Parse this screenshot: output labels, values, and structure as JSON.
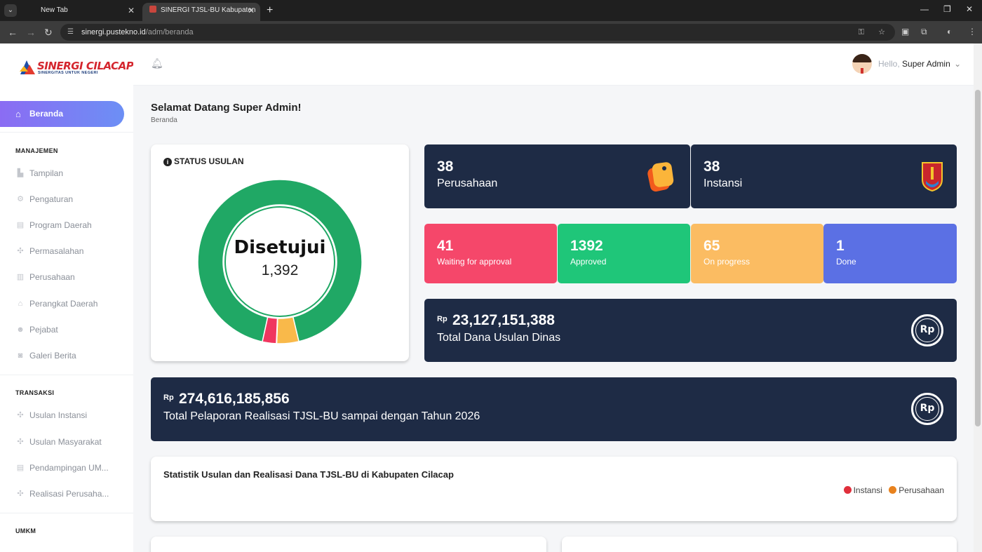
{
  "browser": {
    "tabs": [
      {
        "title": "New Tab"
      },
      {
        "title": "SINERGI TJSL-BU Kabupaten Cil"
      }
    ],
    "url_host": "sinergi.pustekno.id",
    "url_path": "/adm/beranda"
  },
  "logo": {
    "name": "SINERGI CILACAP",
    "tagline": "SINERGITAS UNTUK NEGERI"
  },
  "sidebar": {
    "active": "Beranda",
    "sections": [
      {
        "title": "MANAJEMEN",
        "items": [
          "Tampilan",
          "Pengaturan",
          "Program Daerah",
          "Permasalahan",
          "Perusahaan",
          "Perangkat Daerah",
          "Pejabat",
          "Galeri Berita"
        ]
      },
      {
        "title": "TRANSAKSI",
        "items": [
          "Usulan Instansi",
          "Usulan Masyarakat",
          "Pendampingan UM...",
          "Realisasi Perusaha..."
        ]
      },
      {
        "title": "UMKM",
        "items": []
      }
    ]
  },
  "header": {
    "hello": "Hello,",
    "user": "Super Admin"
  },
  "page": {
    "title": "Selamat Datang Super Admin!",
    "breadcrumb": "Beranda"
  },
  "status_usulan": {
    "title": "STATUS USULAN",
    "center_label": "Disetujui",
    "center_value": "1,392",
    "colors": {
      "approved": "#20a865",
      "progress": "#f9b94a",
      "waiting": "#f0365f",
      "done": "#5468d8"
    }
  },
  "stats_top": [
    {
      "value": "38",
      "label": "Perusahaan"
    },
    {
      "value": "38",
      "label": "Instansi"
    }
  ],
  "stats_status": [
    {
      "value": "41",
      "label": "Waiting for approval",
      "color": "#f5476a"
    },
    {
      "value": "1392",
      "label": "Approved",
      "color": "#1fc679"
    },
    {
      "value": "65",
      "label": "On progress",
      "color": "#fbbc62"
    },
    {
      "value": "1",
      "label": "Done",
      "color": "#5b70e4"
    }
  ],
  "dana_dinas": {
    "currency": "Rp",
    "amount": "23,127,151,388",
    "label": "Total Dana Usulan Dinas"
  },
  "realisasi": {
    "currency": "Rp",
    "amount": "274,616,185,856",
    "label": "Total Pelaporan Realisasi TJSL-BU sampai dengan Tahun 2026"
  },
  "statistik": {
    "title": "Statistik Usulan dan Realisasi Dana TJSL-BU di Kabupaten Cilacap",
    "legend": [
      {
        "name": "Instansi",
        "color": "#e02f3b"
      },
      {
        "name": "Perusahaan",
        "color": "#e8821e"
      }
    ]
  },
  "chart_data": {
    "type": "pie",
    "title": "STATUS USULAN",
    "categories": [
      "Approved",
      "On progress",
      "Done",
      "Waiting for approval"
    ],
    "values": [
      1392,
      65,
      1,
      41
    ]
  }
}
